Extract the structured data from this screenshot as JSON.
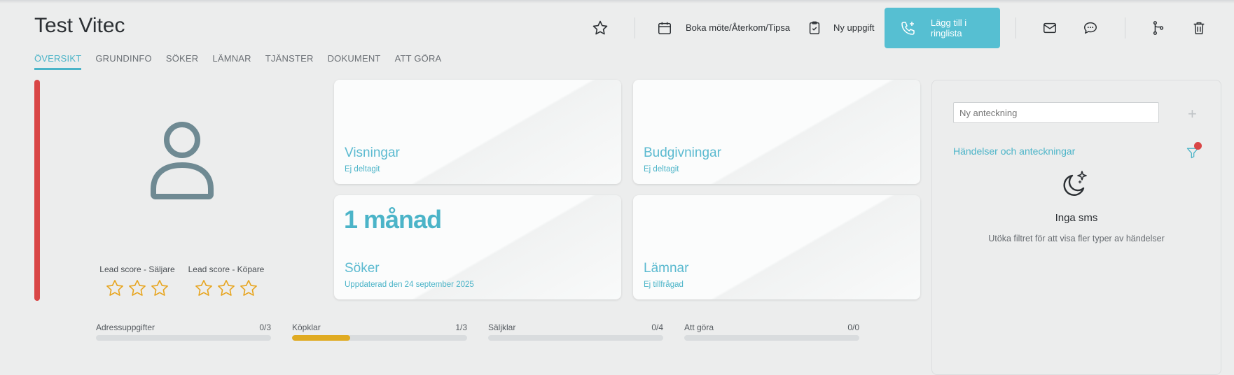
{
  "page_title": "Test Vitec",
  "tabs": [
    "ÖVERSIKT",
    "GRUNDINFO",
    "SÖKER",
    "LÄMNAR",
    "TJÄNSTER",
    "DOKUMENT",
    "ATT GÖRA"
  ],
  "active_tab": "ÖVERSIKT",
  "toolbar": {
    "book_meeting_label": "Boka möte/Återkom/Tipsa",
    "new_task_label": "Ny uppgift",
    "ringlist_label": "Lägg till i ringlista"
  },
  "colors": {
    "accent": "#4bb4c8",
    "button": "#56bfd2",
    "status_bar": "#d94646",
    "progress_fill": "#e0ab22",
    "star": "#e7a51f"
  },
  "lead_scores": [
    {
      "label": "Lead score - Säljare",
      "stars": 0,
      "max": 3
    },
    {
      "label": "Lead score - Köpare",
      "stars": 0,
      "max": 3
    }
  ],
  "cards": [
    {
      "big": "",
      "title": "Visningar",
      "subtitle": "Ej deltagit"
    },
    {
      "big": "",
      "title": "Budgivningar",
      "subtitle": "Ej deltagit"
    },
    {
      "big": "1 månad",
      "title": "Söker",
      "subtitle": "Uppdaterad den 24 september 2025"
    },
    {
      "big": "",
      "title": "Lämnar",
      "subtitle": "Ej tillfrågad"
    }
  ],
  "progress": [
    {
      "label": "Adressuppgifter",
      "value": "0/3",
      "fraction": 0
    },
    {
      "label": "Köpklar",
      "value": "1/3",
      "fraction": 0.333
    },
    {
      "label": "Säljklar",
      "value": "0/4",
      "fraction": 0
    },
    {
      "label": "Att göra",
      "value": "0/0",
      "fraction": 0
    }
  ],
  "panel": {
    "note_placeholder": "Ny anteckning",
    "events_title": "Händelser och anteckningar",
    "empty_title": "Inga sms",
    "empty_subtitle": "Utöka filtret för att visa fler typer av händelser"
  },
  "icons": [
    "star-icon",
    "calendar-icon",
    "clipboard-check-icon",
    "phone-plus-icon",
    "mail-icon",
    "chat-icon",
    "branch-icon",
    "trash-icon",
    "user-icon",
    "filter-icon",
    "moon-stars-icon"
  ]
}
